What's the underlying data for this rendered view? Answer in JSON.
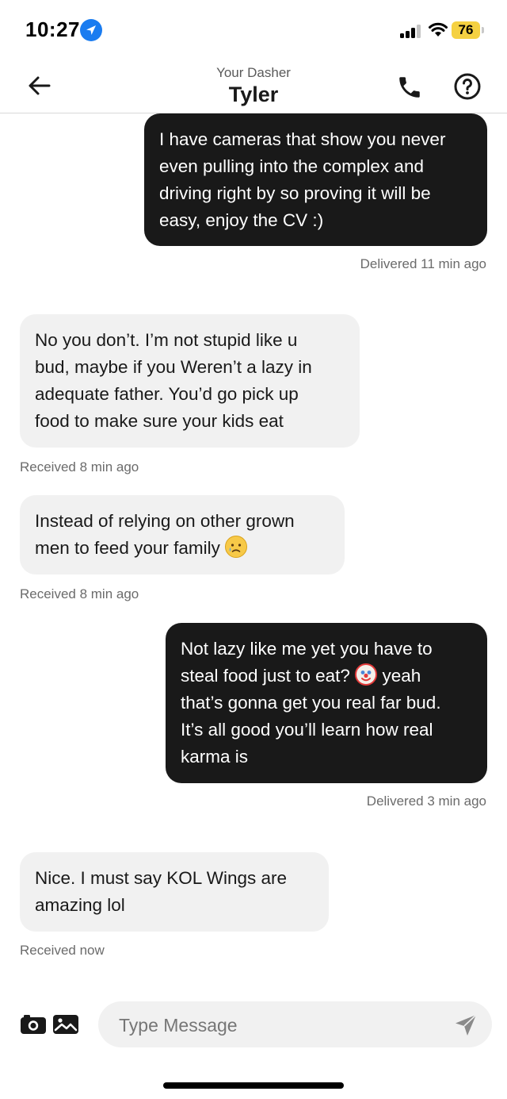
{
  "status_bar": {
    "time": "10:27",
    "location_icon": "location-arrow-icon",
    "signal_icon": "cellular-signal-icon",
    "wifi_icon": "wifi-icon",
    "battery_percent": "76",
    "battery_color": "#f5d142"
  },
  "header": {
    "subtitle": "Your Dasher",
    "title": "Tyler",
    "back_icon": "arrow-left-icon",
    "call_icon": "phone-icon",
    "help_icon": "question-circle-icon"
  },
  "colors": {
    "outgoing_bubble": "#191919",
    "incoming_bubble": "#f1f1f1",
    "meta_text": "#6b6b6b"
  },
  "messages": [
    {
      "direction": "outgoing",
      "lines": [
        "I have cameras that show you never",
        "even pulling into the complex and",
        "driving right by so proving it will be",
        "easy, enjoy the CV :)"
      ],
      "status": "Delivered 11 min ago"
    },
    {
      "direction": "incoming",
      "lines": [
        "No you don’t. I’m not stupid like u",
        "bud, maybe if you Weren’t a lazy in",
        "adequate father. You’d go pick up",
        "food to make sure your kids eat"
      ],
      "status": "Received 8 min ago"
    },
    {
      "direction": "incoming",
      "lines": [
        "Instead of relying on other grown",
        "men to feed your family"
      ],
      "emoji": "sad-tear-face-emoji",
      "status": "Received 8 min ago"
    },
    {
      "direction": "outgoing",
      "lines": [
        "Not lazy like me yet you have to",
        "steal food just to eat?",
        "yeah",
        "that’s gonna get you real far bud.",
        "It’s all good you’ll learn how real",
        "karma is"
      ],
      "emoji": "clown-face-emoji",
      "status": "Delivered 3 min ago"
    },
    {
      "direction": "incoming",
      "lines": [
        "Nice. I must say KOL Wings are",
        "amazing lol"
      ],
      "status": "Received now"
    }
  ],
  "composer": {
    "camera_icon": "camera-icon",
    "gallery_icon": "image-gallery-icon",
    "placeholder": "Type Message",
    "value": "",
    "send_icon": "send-arrow-icon"
  }
}
